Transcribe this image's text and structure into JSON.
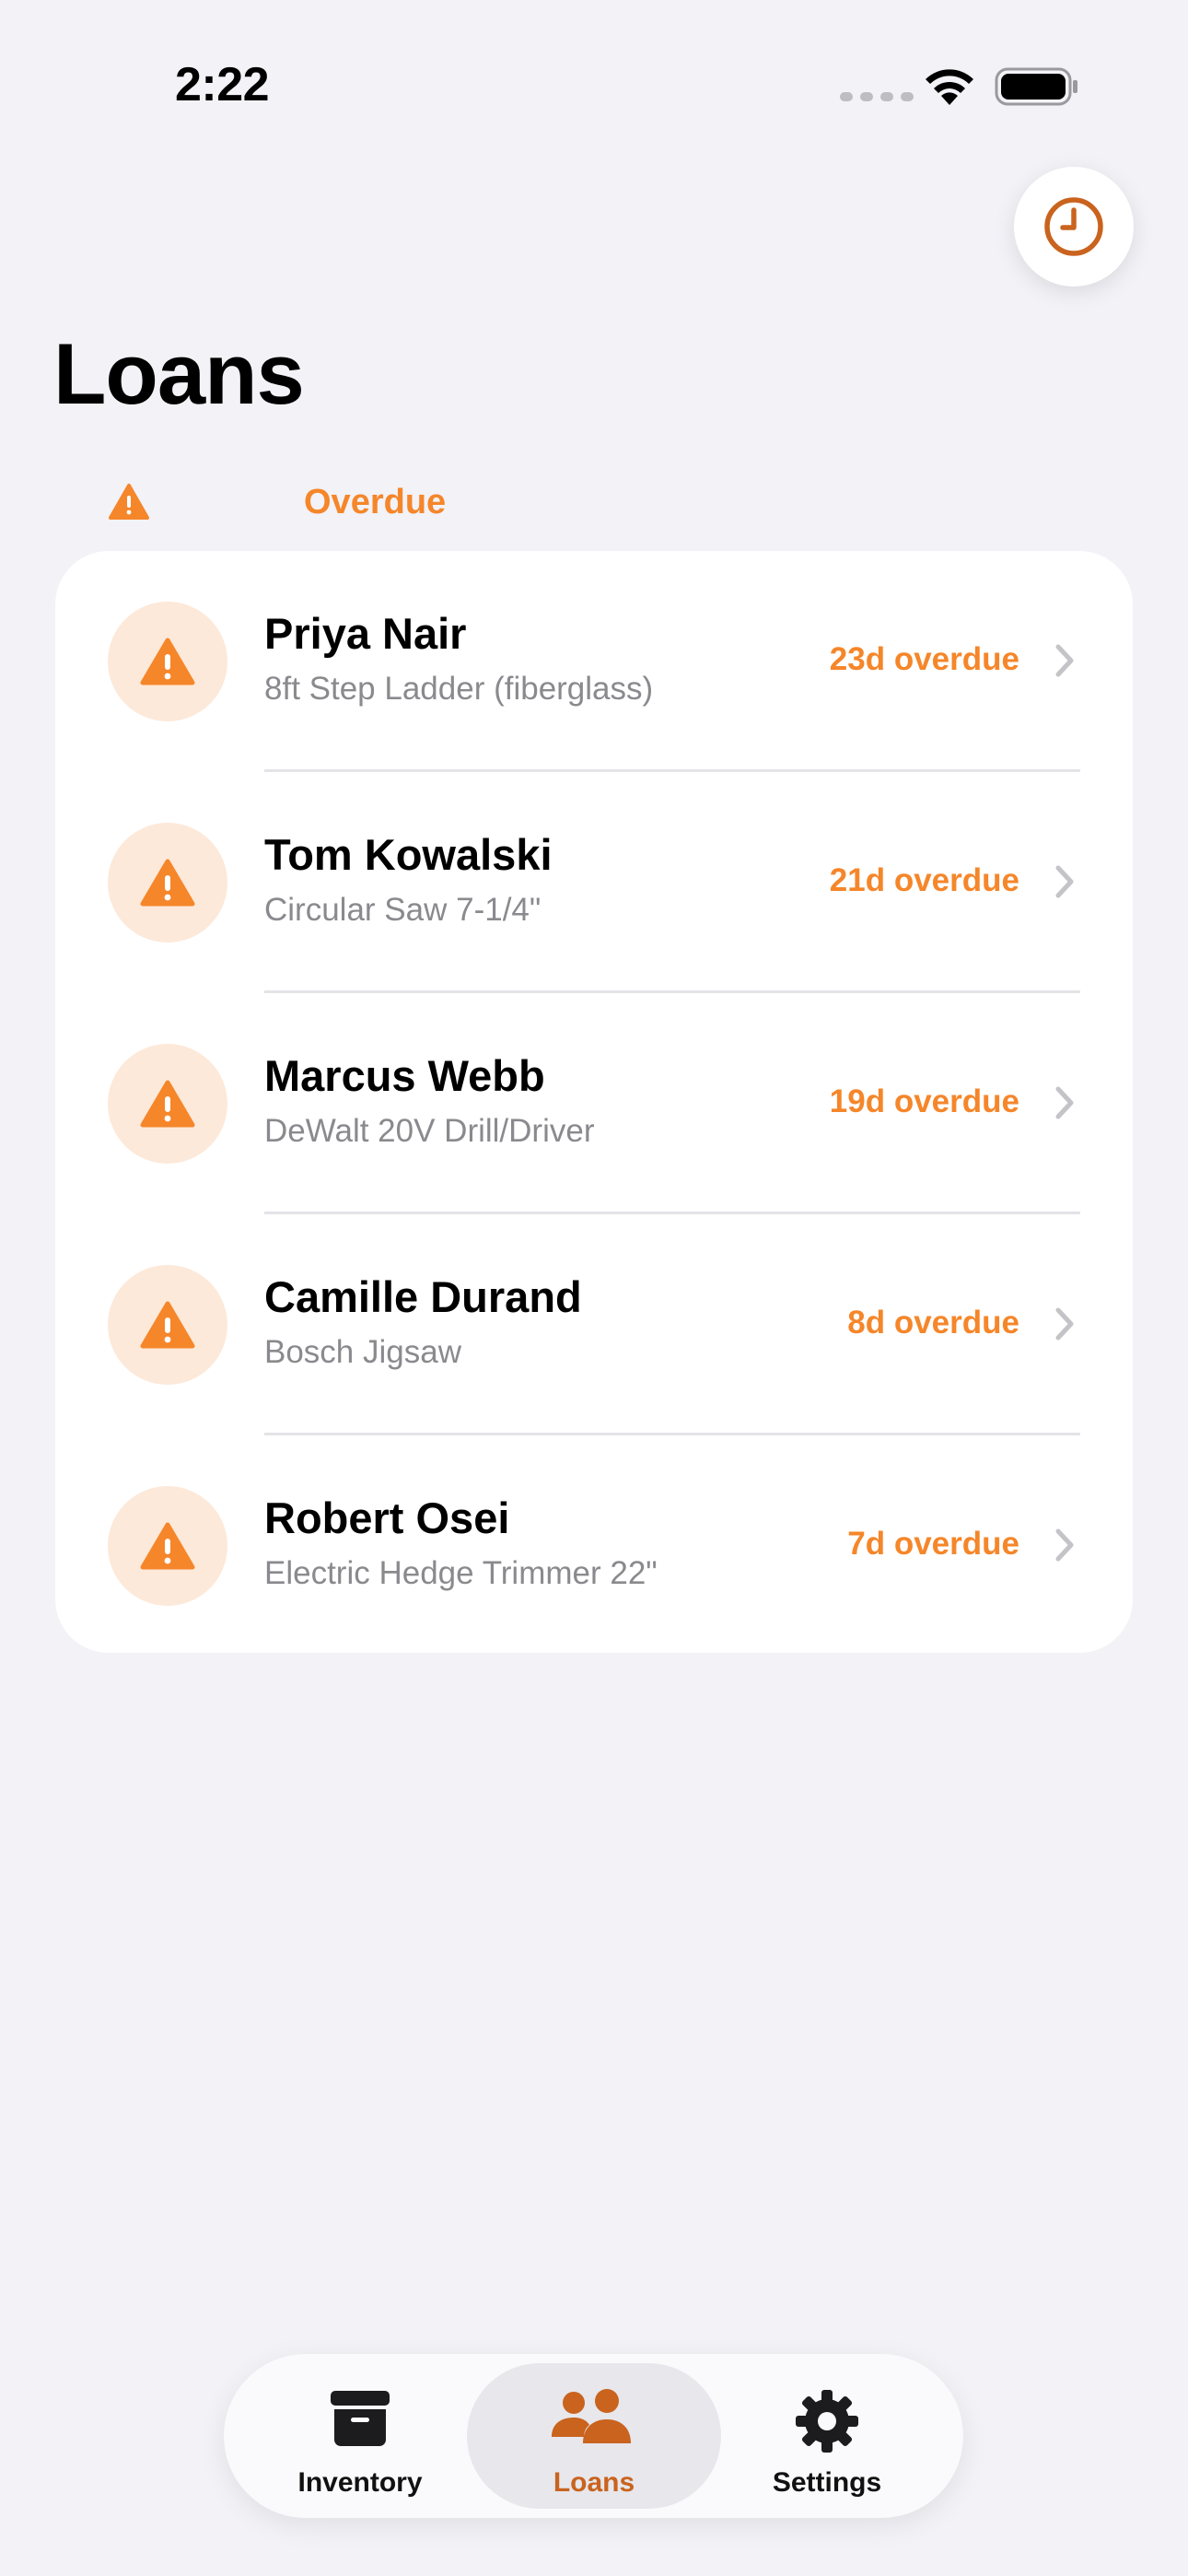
{
  "status_bar": {
    "time": "2:22"
  },
  "header": {
    "title": "Loans"
  },
  "section": {
    "label": "Overdue"
  },
  "loans": [
    {
      "name": "Priya Nair",
      "item": "8ft Step Ladder (fiberglass)",
      "overdue": "23d overdue"
    },
    {
      "name": "Tom Kowalski",
      "item": "Circular Saw 7-1/4\"",
      "overdue": "21d overdue"
    },
    {
      "name": "Marcus Webb",
      "item": "DeWalt 20V Drill/Driver",
      "overdue": "19d overdue"
    },
    {
      "name": "Camille Durand",
      "item": "Bosch Jigsaw",
      "overdue": "8d overdue"
    },
    {
      "name": "Robert Osei",
      "item": "Electric Hedge Trimmer 22\"",
      "overdue": "7d overdue"
    }
  ],
  "tabs": [
    {
      "label": "Inventory",
      "icon": "archive-box-icon"
    },
    {
      "label": "Loans",
      "icon": "people-icon",
      "active": true
    },
    {
      "label": "Settings",
      "icon": "gear-icon"
    }
  ],
  "colors": {
    "accent": "#F5862A",
    "accent_dark": "#C9631E",
    "background": "#F2F2F7",
    "avatar_bg": "#FDE9D9"
  }
}
